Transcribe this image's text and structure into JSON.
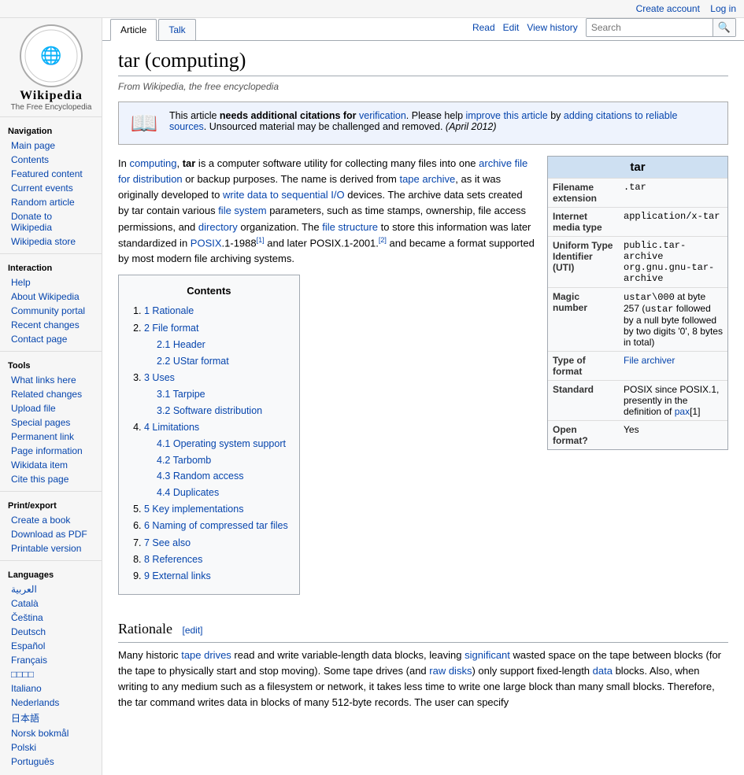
{
  "topbar": {
    "create_account": "Create account",
    "log_in": "Log in"
  },
  "logo": {
    "symbol": "🌐",
    "title": "Wikipedia",
    "subtitle": "The Free Encyclopedia"
  },
  "tabs": {
    "article": "Article",
    "talk": "Talk",
    "read": "Read",
    "edit": "Edit",
    "view_history": "View history"
  },
  "search": {
    "placeholder": "Search",
    "button": "🔍"
  },
  "sidebar": {
    "navigation_title": "Navigation",
    "nav_links": [
      {
        "label": "Main page",
        "name": "main-page"
      },
      {
        "label": "Contents",
        "name": "contents"
      },
      {
        "label": "Featured content",
        "name": "featured-content"
      },
      {
        "label": "Current events",
        "name": "current-events"
      },
      {
        "label": "Random article",
        "name": "random-article"
      },
      {
        "label": "Donate to Wikipedia",
        "name": "donate"
      },
      {
        "label": "Wikipedia store",
        "name": "wikipedia-store"
      }
    ],
    "interaction_title": "Interaction",
    "interaction_links": [
      {
        "label": "Help",
        "name": "help"
      },
      {
        "label": "About Wikipedia",
        "name": "about"
      },
      {
        "label": "Community portal",
        "name": "community-portal"
      },
      {
        "label": "Recent changes",
        "name": "recent-changes"
      },
      {
        "label": "Contact page",
        "name": "contact-page"
      }
    ],
    "tools_title": "Tools",
    "tools_links": [
      {
        "label": "What links here",
        "name": "what-links-here"
      },
      {
        "label": "Related changes",
        "name": "related-changes"
      },
      {
        "label": "Upload file",
        "name": "upload-file"
      },
      {
        "label": "Special pages",
        "name": "special-pages"
      },
      {
        "label": "Permanent link",
        "name": "permanent-link"
      },
      {
        "label": "Page information",
        "name": "page-information"
      },
      {
        "label": "Wikidata item",
        "name": "wikidata-item"
      },
      {
        "label": "Cite this page",
        "name": "cite-this-page"
      }
    ],
    "print_title": "Print/export",
    "print_links": [
      {
        "label": "Create a book",
        "name": "create-book"
      },
      {
        "label": "Download as PDF",
        "name": "download-pdf"
      },
      {
        "label": "Printable version",
        "name": "printable-version"
      }
    ],
    "languages_title": "Languages",
    "languages": [
      {
        "label": "العربية",
        "name": "lang-arabic"
      },
      {
        "label": "Català",
        "name": "lang-catala"
      },
      {
        "label": "Čeština",
        "name": "lang-cestina"
      },
      {
        "label": "Deutsch",
        "name": "lang-deutsch"
      },
      {
        "label": "Español",
        "name": "lang-espanol"
      },
      {
        "label": "Français",
        "name": "lang-francais"
      },
      {
        "label": "日本語",
        "name": "lang-japanese"
      },
      {
        "label": "□□□□",
        "name": "lang-korean"
      },
      {
        "label": "Italiano",
        "name": "lang-italiano"
      },
      {
        "label": "Nederlands",
        "name": "lang-nederlands"
      },
      {
        "label": "日本語",
        "name": "lang-japanese2"
      },
      {
        "label": "Norsk bokmål",
        "name": "lang-norsk"
      },
      {
        "label": "Polski",
        "name": "lang-polski"
      },
      {
        "label": "Português",
        "name": "lang-portugues"
      }
    ]
  },
  "article": {
    "title": "tar (computing)",
    "subtitle": "From Wikipedia, the free encyclopedia",
    "notice": {
      "icon": "📖",
      "text1": "This article ",
      "bold": "needs additional citations for",
      "link1": "verification",
      "text2": ". Please help ",
      "link2": "improve this article",
      "text3": " by ",
      "link3": "adding citations to reliable sources",
      "text4": ". Unsourced material may be challenged and removed. ",
      "date": "(April 2012)"
    },
    "infobox": {
      "title": "tar",
      "rows": [
        {
          "label": "Filename extension",
          "value": ".tar"
        },
        {
          "label": "Internet media type",
          "value": "application/x-tar"
        },
        {
          "label": "Uniform Type Identifier (UTI)",
          "value": "public.tar-archive\norg.gnu.gnu-tar-archive"
        },
        {
          "label": "Magic number",
          "value": "ustar\\000 at byte 257 (ustar followed by a null byte followed by two digits '0', 8 bytes in total)"
        },
        {
          "label": "Type of format",
          "value": "File archiver",
          "link": true
        },
        {
          "label": "Standard",
          "value": "POSIX since POSIX.1, presently in the definition of pax[1]"
        },
        {
          "label": "Open format?",
          "value": "Yes"
        }
      ]
    },
    "intro": "In computing, tar is a computer software utility for collecting many files into one archive file for distribution or backup purposes. The name is derived from tape archive, as it was originally developed to write data to sequential I/O devices. The archive data sets created by tar contain various file system parameters, such as time stamps, ownership, file access permissions, and directory organization. The file structure to store this information was later standardized in POSIX.1-1988[1] and later POSIX.1-2001.[2] and became a format supported by most modern file archiving systems.",
    "toc": {
      "title": "Contents",
      "items": [
        {
          "num": "1",
          "label": "Rationale",
          "anchor": "Rationale"
        },
        {
          "num": "2",
          "label": "File format",
          "anchor": "File_format",
          "sub": [
            {
              "num": "2.1",
              "label": "Header"
            },
            {
              "num": "2.2",
              "label": "UStar format"
            }
          ]
        },
        {
          "num": "3",
          "label": "Uses",
          "anchor": "Uses",
          "sub": [
            {
              "num": "3.1",
              "label": "Tarpipe"
            },
            {
              "num": "3.2",
              "label": "Software distribution"
            }
          ]
        },
        {
          "num": "4",
          "label": "Limitations",
          "anchor": "Limitations",
          "sub": [
            {
              "num": "4.1",
              "label": "Operating system support"
            },
            {
              "num": "4.2",
              "label": "Tarbomb"
            },
            {
              "num": "4.3",
              "label": "Random access"
            },
            {
              "num": "4.4",
              "label": "Duplicates"
            }
          ]
        },
        {
          "num": "5",
          "label": "Key implementations"
        },
        {
          "num": "6",
          "label": "Naming of compressed tar files"
        },
        {
          "num": "7",
          "label": "See also"
        },
        {
          "num": "8",
          "label": "References"
        },
        {
          "num": "9",
          "label": "External links"
        }
      ]
    },
    "rationale_heading": "Rationale",
    "rationale_edit": "[edit]",
    "rationale_text": "Many historic tape drives read and write variable-length data blocks, leaving significant wasted space on the tape between blocks (for the tape to physically start and stop moving). Some tape drives (and raw disks) only support fixed-length data blocks. Also, when writing to any medium such as a filesystem or network, it takes less time to write one large block than many small blocks. Therefore, the tar command writes data in blocks of many 512-byte records. The user can specify"
  }
}
